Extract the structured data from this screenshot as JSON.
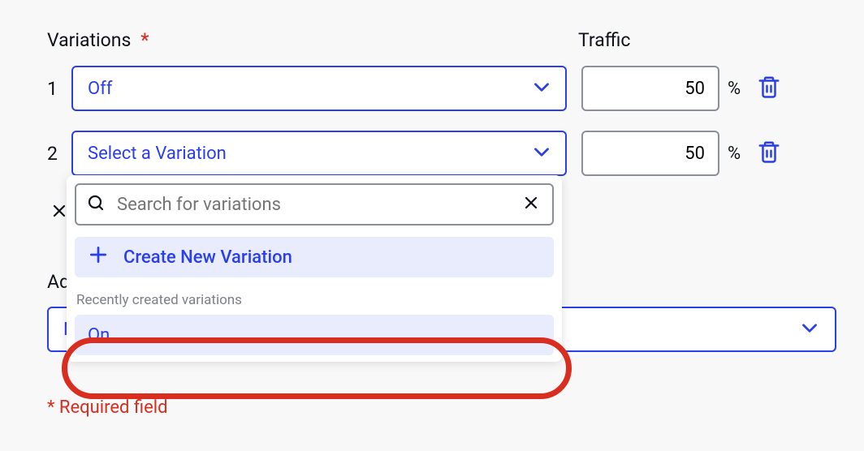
{
  "headers": {
    "variations": "Variations",
    "asterisk": "*",
    "traffic": "Traffic"
  },
  "rows": [
    {
      "index": "1",
      "value": "Off",
      "traffic": "50",
      "unit": "%"
    },
    {
      "index": "2",
      "value": "Select a Variation",
      "traffic": "50",
      "unit": "%"
    }
  ],
  "dropdown": {
    "search_placeholder": "Search for variations",
    "create_label": "Create New Variation",
    "recent_label": "Recently created variations",
    "options": [
      {
        "label": "On"
      }
    ]
  },
  "advanced": {
    "label": "Ad",
    "value": "N"
  },
  "footnote": "* Required field"
}
